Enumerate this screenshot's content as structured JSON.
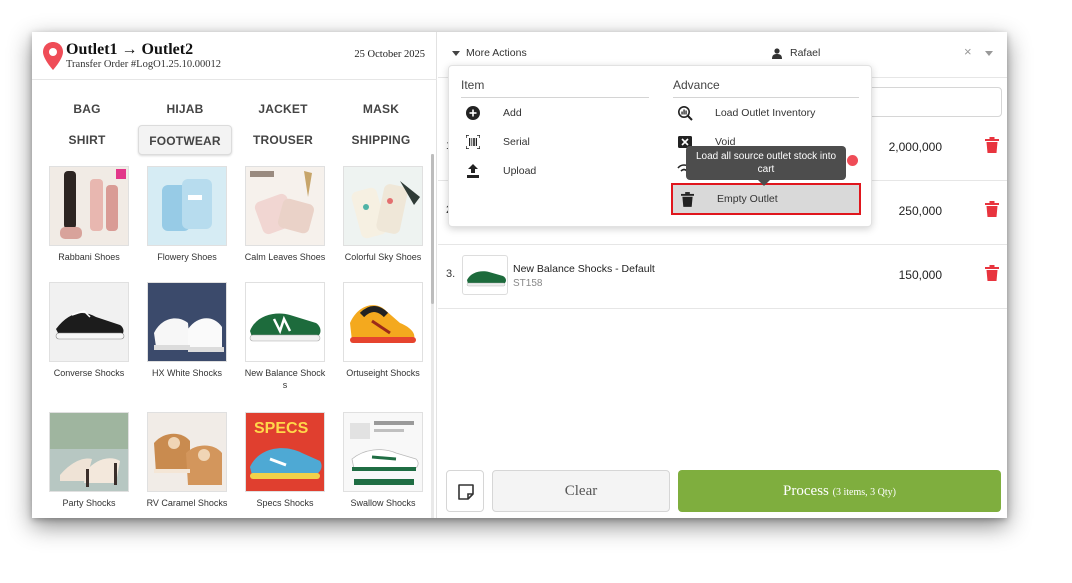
{
  "header": {
    "title": "Outlet1  → Outlet2",
    "subtitle": "Transfer Order #LogO1.25.10.00012",
    "date": "25 October 2025"
  },
  "categories": [
    "BAG",
    "HIJAB",
    "JACKET",
    "MASK",
    "SHIRT",
    "FOOTWEAR",
    "TROUSER",
    "SHIPPING"
  ],
  "active_category": "FOOTWEAR",
  "products": [
    "Rabbani Shoes",
    "Flowery Shoes",
    "Calm Leaves Shoes",
    "Colorful Sky Shoes",
    "Converse Shocks",
    "HX White Shocks",
    "New Balance Shock",
    "Ortuseight Shocks",
    "Party Shocks",
    "RV Caramel Shocks",
    "Specs Shocks",
    "Swallow Shocks"
  ],
  "product_name_overflow": "s",
  "toolbar": {
    "more_actions": "More Actions",
    "user": "Rafael",
    "clear_symbol": "×"
  },
  "cart": [
    {
      "num": "1.",
      "name": "",
      "sku": "",
      "price": "2,000,000"
    },
    {
      "num": "2.",
      "name": "",
      "sku": "",
      "price": "250,000"
    },
    {
      "num": "3.",
      "name": "New Balance Shocks - Default",
      "sku": "ST158",
      "price": "150,000"
    }
  ],
  "dropdown": {
    "item_title": "Item",
    "advance_title": "Advance",
    "item_actions": [
      "Add",
      "Serial",
      "Upload"
    ],
    "advance_actions": [
      "Load Outlet Inventory",
      "Void",
      "Empty Outlet"
    ]
  },
  "tooltip": {
    "line1": "Load all source outlet stock into",
    "line2": "cart"
  },
  "bottom": {
    "clear_label": "Clear",
    "process_label": "Process",
    "process_detail": "(3 items, 3 Qty)"
  },
  "colors": {
    "accent_green": "#7fae3e",
    "delete_red": "#e8343e",
    "highlight_red": "#e0161d",
    "pin_red": "#ef4c57"
  },
  "icons": {
    "location": "map-pin-icon",
    "user": "user-icon",
    "delete": "trash-icon",
    "add": "plus-circle-icon",
    "serial": "barcode-scan-icon",
    "upload": "upload-icon",
    "load_inventory": "magnify-chart-icon",
    "void": "x-box-icon",
    "empty": "trash-icon",
    "note": "sticky-note-icon"
  }
}
